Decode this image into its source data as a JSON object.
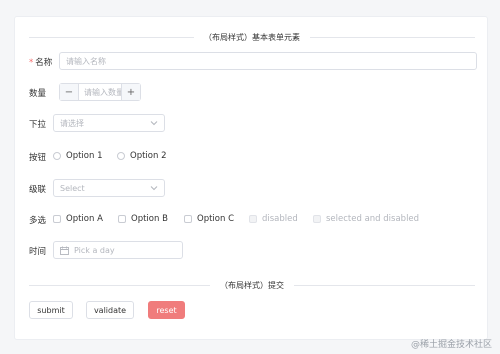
{
  "form": {
    "section_title": "（布局样式）基本表单元素",
    "name": {
      "label": "名称",
      "placeholder": "请输入名称"
    },
    "quantity": {
      "label": "数量",
      "placeholder": "请输入数量",
      "minus": "−",
      "plus": "+"
    },
    "dropdown": {
      "label": "下拉",
      "placeholder": "请选择"
    },
    "radio": {
      "label": "按钮",
      "options": [
        "Option 1",
        "Option 2"
      ]
    },
    "cascader": {
      "label": "级联",
      "placeholder": "Select"
    },
    "checkbox": {
      "label": "多选",
      "options": [
        "Option A",
        "Option B",
        "Option C",
        "disabled",
        "selected and disabled"
      ]
    },
    "time": {
      "label": "时间",
      "placeholder": "Pick a day"
    },
    "submit_section_title": "（布局样式）提交",
    "buttons": {
      "submit": "submit",
      "validate": "validate",
      "reset": "reset"
    }
  },
  "watermark": "@稀土掘金技术社区",
  "colors": {
    "required": "#f56c6c",
    "reset_button": "#f07c7c"
  }
}
